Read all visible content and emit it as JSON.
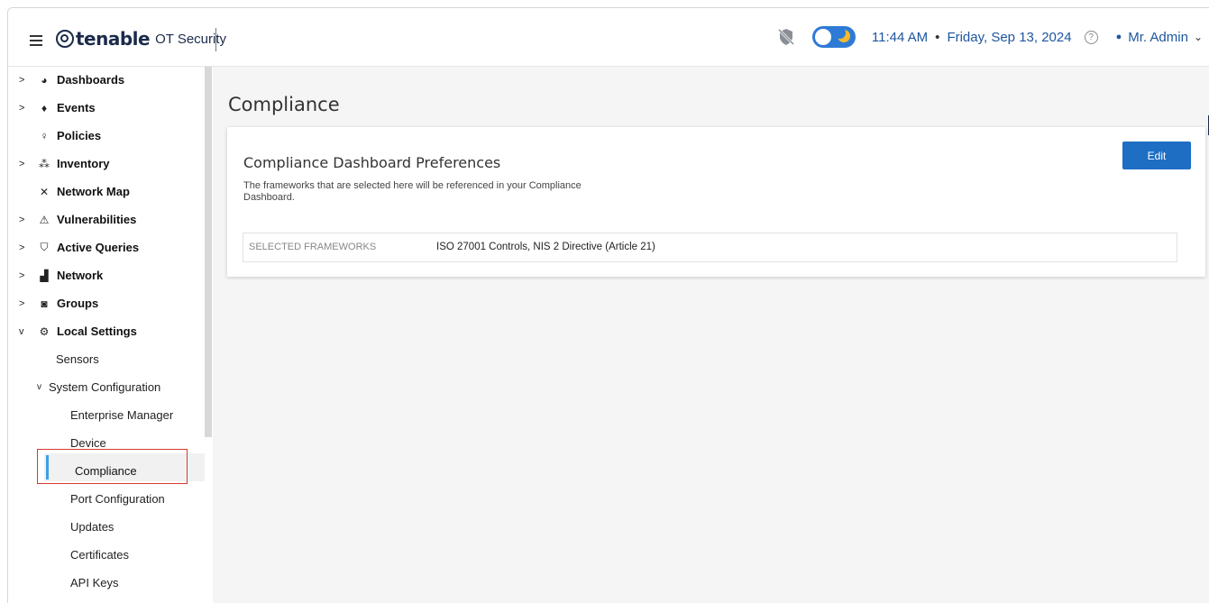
{
  "header": {
    "logo_word": "tenable",
    "logo_sub": "OT Security",
    "time": "11:44 AM",
    "separator": "•",
    "date": "Friday, Sep 13, 2024",
    "help_symbol": "?",
    "user": "Mr. Admin",
    "accent_color": "#1e56a0",
    "toggle_color": "#2e7bd6"
  },
  "sidebar": {
    "items": [
      {
        "label": "Dashboards",
        "icon": "dashboard-icon",
        "expand": ">"
      },
      {
        "label": "Events",
        "icon": "bell-icon",
        "expand": ">"
      },
      {
        "label": "Policies",
        "icon": "policy-icon",
        "expand": ""
      },
      {
        "label": "Inventory",
        "icon": "inventory-icon",
        "expand": ">"
      },
      {
        "label": "Network Map",
        "icon": "network-map-icon",
        "expand": ""
      },
      {
        "label": "Vulnerabilities",
        "icon": "bug-icon",
        "expand": ">"
      },
      {
        "label": "Active Queries",
        "icon": "shield-icon",
        "expand": ">"
      },
      {
        "label": "Network",
        "icon": "network-icon",
        "expand": ">"
      },
      {
        "label": "Groups",
        "icon": "groups-icon",
        "expand": ">"
      },
      {
        "label": "Local Settings",
        "icon": "settings-icon",
        "expand": "v"
      }
    ],
    "sub_items": {
      "sensors": "Sensors",
      "system_configuration": "System Configuration",
      "enterprise_manager": "Enterprise Manager",
      "device": "Device",
      "compliance": "Compliance",
      "port_configuration": "Port Configuration",
      "updates": "Updates",
      "certificates": "Certificates",
      "api_keys": "API Keys"
    },
    "active_item": "Compliance",
    "highlight_color": "#d43b2f"
  },
  "main": {
    "page_title": "Compliance",
    "card": {
      "title": "Compliance Dashboard Preferences",
      "description": "The frameworks that are selected here will be referenced in your Compliance Dashboard.",
      "edit_label": "Edit",
      "frameworks_label": "SELECTED FRAMEWORKS",
      "frameworks_value": "ISO 27001 Controls, NIS 2 Directive (Article 21)"
    }
  }
}
